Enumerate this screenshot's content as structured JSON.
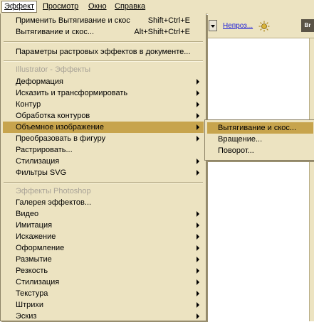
{
  "menubar": {
    "items": [
      {
        "label": "Эффект"
      },
      {
        "label": "Просмотр"
      },
      {
        "label": "Окно"
      },
      {
        "label": "Справка"
      }
    ]
  },
  "toolbar": {
    "link_label": "Непроз..."
  },
  "menu": {
    "top": [
      {
        "label": "Применить Вытягивание и скос",
        "shortcut": "Shift+Ctrl+E"
      },
      {
        "label": "Вытягивание и скос...",
        "shortcut": "Alt+Shift+Ctrl+E"
      }
    ],
    "raster_settings": "Параметры растровых эффектов в документе...",
    "illustrator_header": "Illustrator - Эффекты",
    "illustrator_items": [
      {
        "label": "Деформация"
      },
      {
        "label": "Исказить и трансформировать"
      },
      {
        "label": "Контур"
      },
      {
        "label": "Обработка контуров"
      },
      {
        "label": "Объемное изображение"
      },
      {
        "label": "Преобразовать в фигуру"
      },
      {
        "label": "Растрировать..."
      },
      {
        "label": "Стилизация"
      },
      {
        "label": "Фильтры SVG"
      }
    ],
    "photoshop_header": "Эффекты Photoshop",
    "photoshop_items": [
      {
        "label": "Галерея эффектов..."
      },
      {
        "label": "Видео"
      },
      {
        "label": "Имитация"
      },
      {
        "label": "Искажение"
      },
      {
        "label": "Оформление"
      },
      {
        "label": "Размытие"
      },
      {
        "label": "Резкость"
      },
      {
        "label": "Стилизация"
      },
      {
        "label": "Текстура"
      },
      {
        "label": "Штрихи"
      },
      {
        "label": "Эскиз"
      }
    ]
  },
  "submenu": {
    "items": [
      {
        "label": "Вытягивание и скос..."
      },
      {
        "label": "Вращение..."
      },
      {
        "label": "Поворот..."
      }
    ]
  },
  "colors": {
    "menu_bg": "#ece3c1",
    "highlight": "#c7a44d",
    "section_text": "#a9a397",
    "link": "#1a1ad8"
  }
}
